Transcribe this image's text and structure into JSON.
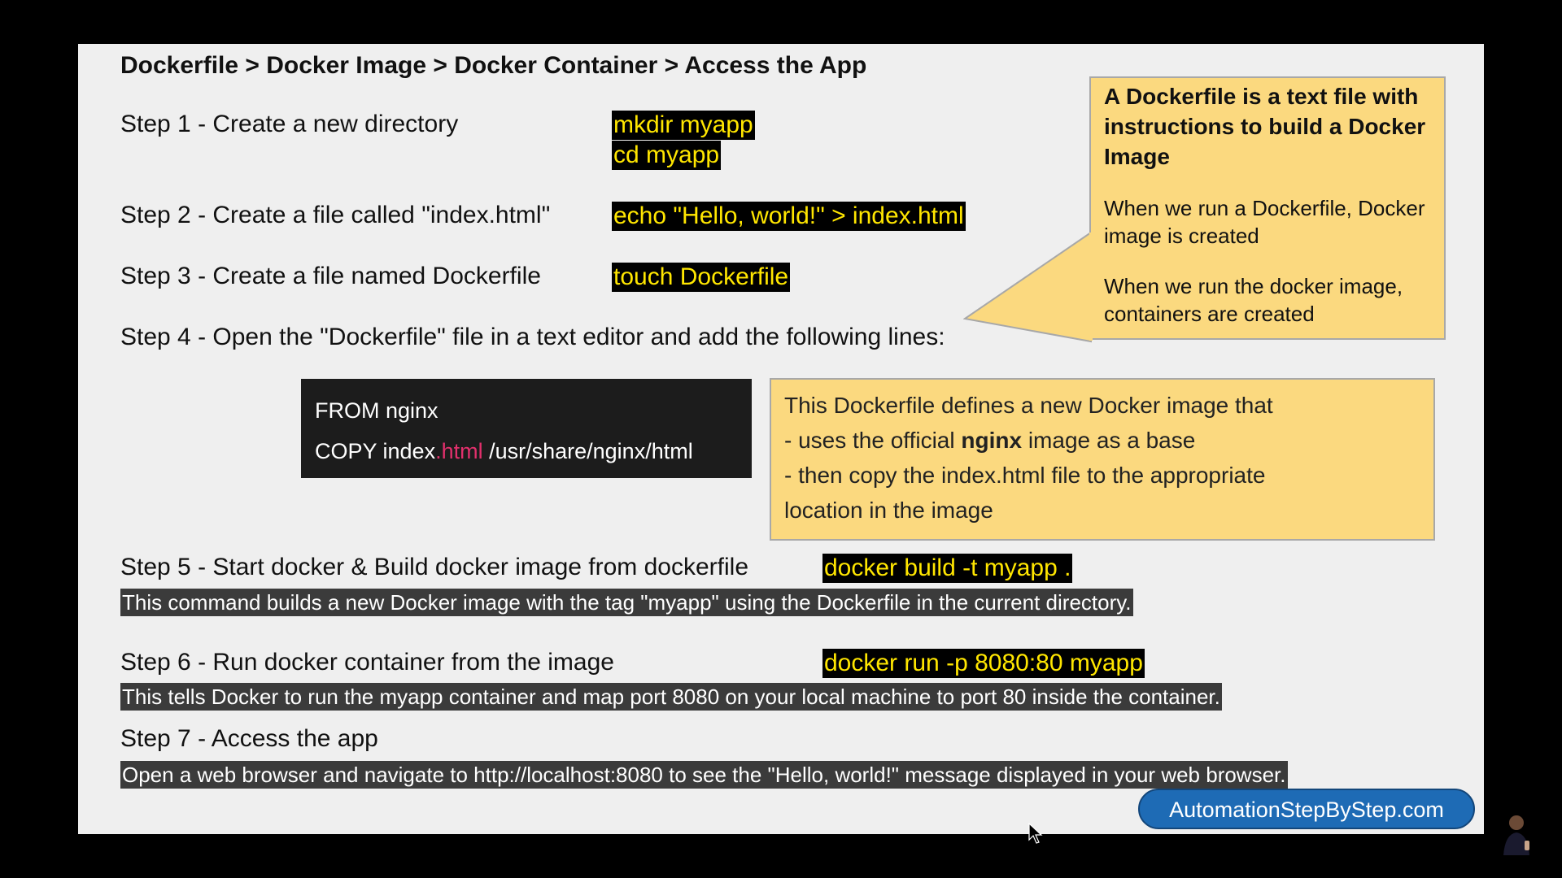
{
  "title": "Dockerfile > Docker Image > Docker Container > Access the App",
  "steps": {
    "s1": {
      "label": "Step 1 - Create a new directory",
      "cmd1": "mkdir myapp",
      "cmd2": "cd myapp"
    },
    "s2": {
      "label": "Step 2 - Create a file called \"index.html\"",
      "cmd": "echo \"Hello, world!\" > index.html"
    },
    "s3": {
      "label": "Step 3 - Create a file named Dockerfile",
      "cmd": "touch Dockerfile"
    },
    "s4": {
      "label": "Step 4 - Open the \"Dockerfile\" file in a text editor and add the following lines:"
    },
    "s5": {
      "label": "Step 5 - Start docker & Build docker image from dockerfile",
      "cmd": "docker build -t myapp .",
      "desc": "This command builds a new Docker image with the tag \"myapp\" using the Dockerfile in the current directory."
    },
    "s6": {
      "label": "Step 6 - Run docker container from the image",
      "cmd": "docker run -p 8080:80 myapp",
      "desc": "This tells Docker to run the myapp container and map port 8080 on your local machine to port 80 inside the container."
    },
    "s7": {
      "label": "Step 7 - Access the app",
      "desc": "Open a web browser and navigate to http://localhost:8080 to see the \"Hello, world!\" message displayed in your web browser."
    }
  },
  "callout": {
    "heading": "A Dockerfile is a text file with instructions to build a Docker Image",
    "para1": "When we run a Dockerfile, Docker image is created",
    "para2": "When we run the docker image, containers are created"
  },
  "code": {
    "line1": "FROM nginx",
    "line2_a": "COPY index",
    "line2_b": ".html",
    "line2_c": " /usr/share/nginx/html"
  },
  "note": {
    "line1": "This Dockerfile defines a new Docker image that",
    "line2_a": "- uses the official ",
    "line2_bold": "nginx",
    "line2_b": " image as a base",
    "line3": "- then copy the index.html file to the appropriate",
    "line4": "location in the image"
  },
  "brand": "AutomationStepByStep.com",
  "colors": {
    "slide_bg": "#efefef",
    "command_bg": "#000000",
    "command_text": "#ffe600",
    "callout_bg": "#fbd97f",
    "brand_bg": "#1e6bb5"
  }
}
